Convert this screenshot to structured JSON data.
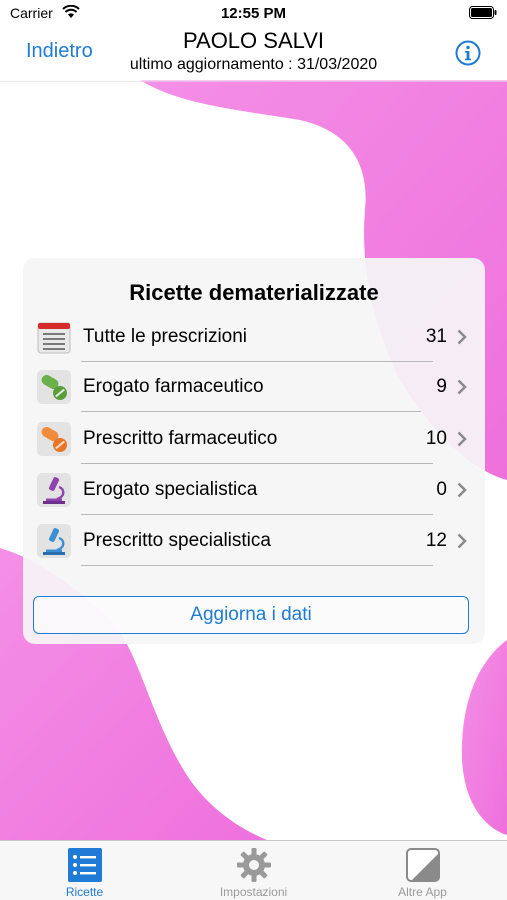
{
  "status_bar": {
    "carrier": "Carrier",
    "time": "12:55 PM"
  },
  "nav": {
    "back_label": "Indietro",
    "title": "PAOLO SALVI",
    "subtitle": "ultimo aggiornamento : 31/03/2020",
    "info_icon": "info-icon"
  },
  "card": {
    "title": "Ricette dematerializzate",
    "rows": [
      {
        "label": "Tutte le prescrizioni",
        "count": "31",
        "icon": "calendar-list-icon"
      },
      {
        "label": "Erogato farmaceutico",
        "count": "9",
        "icon": "green-pills-icon"
      },
      {
        "label": "Prescritto farmaceutico",
        "count": "10",
        "icon": "orange-pills-icon"
      },
      {
        "label": "Erogato specialistica",
        "count": "0",
        "icon": "purple-microscope-icon"
      },
      {
        "label": "Prescritto specialistica",
        "count": "12",
        "icon": "blue-microscope-icon"
      }
    ],
    "refresh_label": "Aggiorna i dati"
  },
  "tab_bar": {
    "tabs": [
      {
        "label": "Ricette",
        "icon": "list-icon",
        "active": true
      },
      {
        "label": "Impostazioni",
        "icon": "gear-icon",
        "active": false
      },
      {
        "label": "Altre App",
        "icon": "apps-icon",
        "active": false
      }
    ]
  },
  "colors": {
    "accent": "#1f7bd6",
    "blob": "#f27fe0",
    "inactive_tab": "#9a9a9a"
  }
}
